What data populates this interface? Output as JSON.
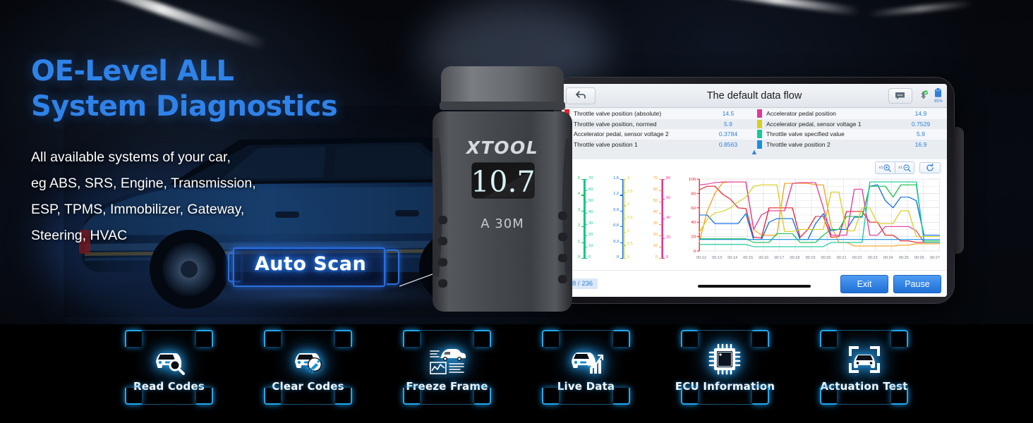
{
  "hero": {
    "headline_line1": "OE-Level ALL",
    "headline_line2": "System Diagnostics",
    "headline_color": "#2f82e8",
    "body_line1": "All available systems of your car,",
    "body_line2": "eg ABS, SRS, Engine, Transmission,",
    "body_line3": "ESP, TPMS, Immobilizer, Gateway,",
    "body_line4": "Steering, HVAC",
    "auto_scan_label": "Auto Scan"
  },
  "device": {
    "brand": "XTOOL",
    "display_value": "10.7",
    "model": "A 30M"
  },
  "tablet": {
    "appbar": {
      "back_icon": "back-arrow-icon",
      "title": "The default data flow",
      "chat_icon": "chat-bubble-icon",
      "bluetooth_icon": "bluetooth-connected-icon",
      "battery_icon": "battery-icon",
      "battery_percent": "85%"
    },
    "legend": [
      {
        "color": "#e8212b",
        "name": "Throttle valve position (absolute)",
        "value": "14.5"
      },
      {
        "color": "#f5a01e",
        "name": "Throttle valve position, normed",
        "value": "5.9"
      },
      {
        "color": "#0a6ae8",
        "name": "Accelerator pedal, sensor voltage 2",
        "value": "0.3784"
      },
      {
        "color": "#15c24a",
        "name": "Throttle valve position 1",
        "value": "0.8563"
      },
      {
        "color": "#e0399a",
        "name": "Accelerator pedal position",
        "value": "14.9"
      },
      {
        "color": "#d6d020",
        "name": "Accelerator pedal, sensor voltage 1",
        "value": "0.7529"
      },
      {
        "color": "#14ca9a",
        "name": "Throttle valve specified value",
        "value": "5.9"
      },
      {
        "color": "#1a8fe0",
        "name": "Throttle valve position 2",
        "value": "16.9"
      }
    ],
    "collapse_icon": "chevron-up-double-icon",
    "toolbar": {
      "zoom_in_label": "x1",
      "zoom_in_icon": "magnifier-plus-icon",
      "zoom_out_label": "x1",
      "zoom_out_icon": "magnifier-minus-icon",
      "refresh_icon": "refresh-icon"
    },
    "bottom": {
      "counter": "8 / 236",
      "exit_label": "Exit",
      "pause_label": "Pause"
    }
  },
  "chart_data": {
    "type": "line",
    "title": "The default data flow",
    "xlabel": "",
    "ylabel": "",
    "grid": true,
    "legend_position": "top",
    "x": [
      "00:12",
      "00:13",
      "00:14",
      "00:15",
      "00:16",
      "00:17",
      "00:18",
      "00:19",
      "00:20",
      "00:21",
      "00:22",
      "00:23",
      "00:24",
      "00:25",
      "00:26",
      "00:27"
    ],
    "side_axes": [
      {
        "color": "#15c24a",
        "label": "Throttle valve position 1",
        "ticks": [
          "0",
          "1",
          "2",
          "3",
          "4",
          "5"
        ],
        "range": [
          0,
          5
        ]
      },
      {
        "color": "#14ca9a",
        "label": "Throttle valve specified value",
        "ticks": [
          "0",
          "10",
          "20",
          "30",
          "40",
          "50",
          "60",
          "70"
        ],
        "range": [
          0,
          70
        ]
      },
      {
        "color": "#0a6ae8",
        "label": "Accelerator pedal, sensor voltage 2",
        "ticks": [
          "0",
          "0.3",
          "0.6",
          "0.9",
          "1.2",
          "1.5"
        ],
        "range": [
          0,
          1.5
        ]
      },
      {
        "color": "#d6d020",
        "label": "Accelerator pedal, sensor voltage 1",
        "ticks": [
          "0",
          "0.5",
          "1",
          "1.5",
          "2",
          "2.5",
          "3"
        ],
        "range": [
          0,
          3
        ]
      },
      {
        "color": "#f5a01e",
        "label": "Throttle valve position, normed",
        "ticks": [
          "0",
          "10",
          "20",
          "30",
          "40",
          "50",
          "60",
          "70"
        ],
        "range": [
          0,
          70
        ]
      },
      {
        "color": "#e0399a",
        "label": "Accelerator pedal position",
        "ticks": [
          "0",
          "20",
          "40",
          "60",
          "80"
        ],
        "range": [
          0,
          80
        ]
      }
    ],
    "main_axis": {
      "color": "#e8212b",
      "ticks": [
        "0",
        "20",
        "40",
        "60",
        "80",
        "100"
      ],
      "range": [
        0,
        100
      ]
    },
    "series": [
      {
        "name": "Throttle valve position (absolute)",
        "color": "#e8212b",
        "values": [
          85,
          90,
          90,
          79,
          72,
          60,
          59,
          19,
          18,
          60,
          60,
          60,
          60,
          19,
          30,
          48,
          48,
          19,
          20,
          55,
          55,
          55,
          40,
          40,
          22,
          22,
          14,
          14,
          12,
          12,
          12,
          12
        ]
      },
      {
        "name": "Throttle valve position, normed",
        "color": "#f5a01e",
        "values": [
          13,
          55,
          80,
          95,
          96,
          96,
          96,
          30,
          22,
          22,
          22,
          94,
          94,
          94,
          94,
          92,
          92,
          35,
          12,
          12,
          7,
          7,
          7,
          7,
          7,
          7,
          8,
          8,
          10,
          10,
          10,
          10
        ]
      },
      {
        "name": "Accelerator pedal, sensor voltage 2",
        "color": "#0a6ae8",
        "values": [
          50,
          50,
          38,
          38,
          38,
          38,
          52,
          16,
          16,
          40,
          45,
          45,
          45,
          16,
          16,
          38,
          52,
          28,
          30,
          30,
          47,
          47,
          90,
          92,
          70,
          60,
          75,
          75,
          70,
          22,
          22,
          22
        ]
      },
      {
        "name": "Throttle valve position 1",
        "color": "#15c24a",
        "values": [
          17,
          17,
          17,
          17,
          17,
          17,
          17,
          12,
          12,
          12,
          24,
          24,
          24,
          12,
          12,
          12,
          22,
          30,
          30,
          48,
          48,
          48,
          90,
          90,
          90,
          75,
          92,
          92,
          92,
          14,
          14,
          14
        ]
      },
      {
        "name": "Accelerator pedal position",
        "color": "#e0399a",
        "values": [
          92,
          93,
          95,
          96,
          96,
          96,
          96,
          30,
          50,
          56,
          56,
          56,
          94,
          95,
          95,
          95,
          60,
          22,
          22,
          22,
          86,
          86,
          22,
          22,
          34,
          34,
          34,
          34,
          28,
          12,
          12,
          12
        ]
      },
      {
        "name": "Accelerator pedal, sensor voltage 1",
        "color": "#d6d020",
        "values": [
          26,
          44,
          53,
          55,
          60,
          68,
          75,
          90,
          92,
          92,
          92,
          27,
          27,
          30,
          30,
          30,
          30,
          82,
          82,
          28,
          28,
          60,
          60,
          38,
          38,
          38,
          56,
          56,
          20,
          20,
          20,
          20
        ]
      },
      {
        "name": "Throttle valve specified value",
        "color": "#14ca9a",
        "values": [
          9,
          9,
          9,
          9,
          9,
          9,
          9,
          6,
          6,
          6,
          6,
          6,
          6,
          6,
          6,
          6,
          6,
          12,
          12,
          12,
          12,
          12,
          96,
          96,
          96,
          96,
          96,
          96,
          96,
          12,
          12,
          12
        ]
      },
      {
        "name": "Throttle valve position 2",
        "color": "#1a8fe0",
        "values": [
          16,
          16,
          16,
          16,
          16,
          16,
          16,
          16,
          16,
          16,
          16,
          16,
          16,
          16,
          16,
          16,
          16,
          16,
          16,
          16,
          16,
          16,
          16,
          16,
          16,
          16,
          16,
          16,
          16,
          16,
          16,
          16
        ]
      }
    ]
  },
  "features": [
    {
      "label": "Read Codes",
      "icon": "car-magnifier-icon"
    },
    {
      "label": "Clear Codes",
      "icon": "car-brush-icon"
    },
    {
      "label": "Freeze Frame",
      "icon": "car-report-chart-icon"
    },
    {
      "label": "Live Data",
      "icon": "car-bar-chart-icon"
    },
    {
      "label": "ECU Information",
      "icon": "microchip-icon"
    },
    {
      "label": "Actuation Test",
      "icon": "car-scan-frame-icon"
    }
  ]
}
